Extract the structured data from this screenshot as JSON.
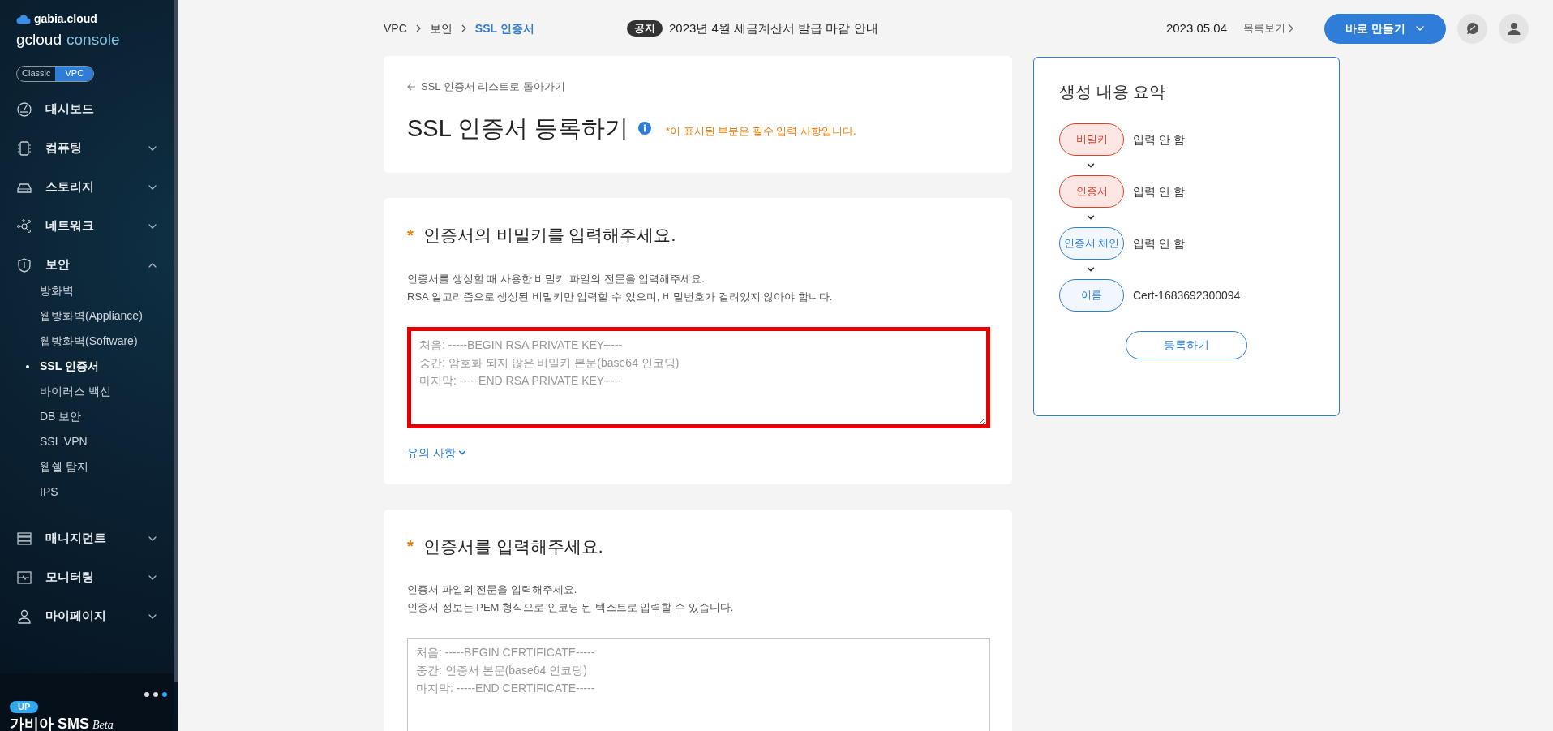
{
  "sidebar": {
    "brand": "gabia.cloud",
    "title": "gcloud",
    "subtitle": "console",
    "mode_toggle": [
      {
        "label": "Classic",
        "selected": false
      },
      {
        "label": "VPC",
        "selected": true
      }
    ],
    "items": [
      {
        "label": "대시보드",
        "kind": "link"
      },
      {
        "label": "컴퓨팅",
        "kind": "group",
        "expanded": false
      },
      {
        "label": "스토리지",
        "kind": "group",
        "expanded": false
      },
      {
        "label": "네트워크",
        "kind": "group",
        "expanded": false
      },
      {
        "label": "보안",
        "kind": "group",
        "expanded": true,
        "children": [
          {
            "label": "방화벽",
            "selected": false
          },
          {
            "label": "웹방화벽(Appliance)",
            "selected": false
          },
          {
            "label": "웹방화벽(Software)",
            "selected": false
          },
          {
            "label": "SSL 인증서",
            "selected": true
          },
          {
            "label": "바이러스 백신",
            "selected": false
          },
          {
            "label": "DB 보안",
            "selected": false
          },
          {
            "label": "SSL VPN",
            "selected": false
          },
          {
            "label": "웹쉘 탐지",
            "selected": false
          },
          {
            "label": "IPS",
            "selected": false
          }
        ]
      },
      {
        "label": "매니지먼트",
        "kind": "group",
        "expanded": false
      },
      {
        "label": "모니터링",
        "kind": "group",
        "expanded": false
      },
      {
        "label": "마이페이지",
        "kind": "group",
        "expanded": false
      }
    ],
    "banner": {
      "badge": "UP",
      "title": "가비아 SMS",
      "suffix": "Beta",
      "dots": [
        {
          "selected": false
        },
        {
          "selected": false
        },
        {
          "selected": true
        }
      ]
    }
  },
  "topbar": {
    "breadcrumb": [
      {
        "label": "VPC",
        "selected": false
      },
      {
        "label": "보안",
        "selected": false
      },
      {
        "label": "SSL 인증서",
        "selected": true
      }
    ],
    "notice": {
      "badge": "공지",
      "text": "2023년 4월 세금계산서 발급 마감 안내",
      "date": "2023.05.04",
      "more": "목록보기"
    },
    "create_button": "바로 만들기"
  },
  "header": {
    "back_link": "SSL 인증서 리스트로 돌아가기",
    "title": "SSL 인증서 등록하기",
    "required_note": "*이 표시된 부분은 필수 입력 사항입니다."
  },
  "sections": [
    {
      "required_mark": "*",
      "title": "인증서의 비밀키를 입력해주세요.",
      "description": [
        "인증서를 생성할 때 사용한 비밀키 파일의 전문을 입력해주세요.",
        "RSA 알고리즘으로 생성된 비밀키만 입력할 수 있으며, 비밀번호가 걸려있지 않아야 합니다."
      ],
      "placeholder": "처음: -----BEGIN RSA PRIVATE KEY-----\n중간: 암호화 되지 않은 비밀키 본문(base64 인코딩)\n마지막: -----END RSA PRIVATE KEY-----",
      "invalid": true,
      "notes_link": "유의 사항"
    },
    {
      "required_mark": "*",
      "title": "인증서를 입력해주세요.",
      "description": [
        "인증서 파일의 전문을 입력해주세요.",
        "인증서 정보는 PEM 형식으로 인코딩 된 텍스트로 입력할 수 있습니다."
      ],
      "placeholder": "처음: -----BEGIN CERTIFICATE-----\n중간: 인증서 본문(base64 인코딩)\n마지막: -----END CERTIFICATE-----",
      "invalid": false
    }
  ],
  "summary": {
    "title": "생성 내용 요약",
    "steps": [
      {
        "label": "비밀키",
        "value": "입력 안 함",
        "invalid": true
      },
      {
        "label": "인증서",
        "value": "입력 안 함",
        "invalid": true
      },
      {
        "label": "인증서 체인",
        "value": "입력 안 함",
        "invalid": false
      },
      {
        "label": "이름",
        "value": "Cert-1683692300094",
        "invalid": false
      }
    ],
    "button": "등록하기"
  }
}
